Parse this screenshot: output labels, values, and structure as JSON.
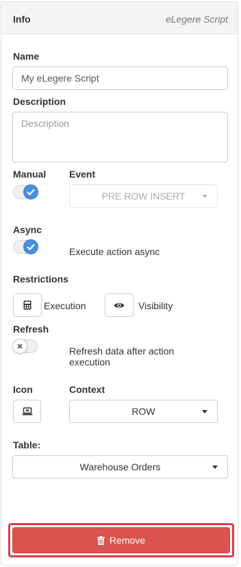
{
  "header": {
    "title": "Info",
    "subtitle": "eLegere Script"
  },
  "name": {
    "label": "Name",
    "value": "My eLegere Script"
  },
  "description": {
    "label": "Description",
    "placeholder": "Description"
  },
  "manual": {
    "label": "Manual",
    "on": true
  },
  "event": {
    "label": "Event",
    "value": "PRE ROW INSERT"
  },
  "async": {
    "label": "Async",
    "on": true,
    "caption": "Execute action async"
  },
  "restrictions": {
    "label": "Restrictions",
    "execution_label": "Execution",
    "visibility_label": "Visibility"
  },
  "refresh": {
    "label": "Refresh",
    "on": false,
    "caption_line1": "Refresh data after action",
    "caption_line2": "execution"
  },
  "icon": {
    "label": "Icon"
  },
  "context": {
    "label": "Context",
    "value": "ROW"
  },
  "table": {
    "label": "Table:",
    "value": "Warehouse Orders"
  },
  "remove": {
    "label": "Remove"
  },
  "colors": {
    "accent": "#4a90d9",
    "danger": "#d9534f",
    "highlight": "#dc3a46"
  }
}
